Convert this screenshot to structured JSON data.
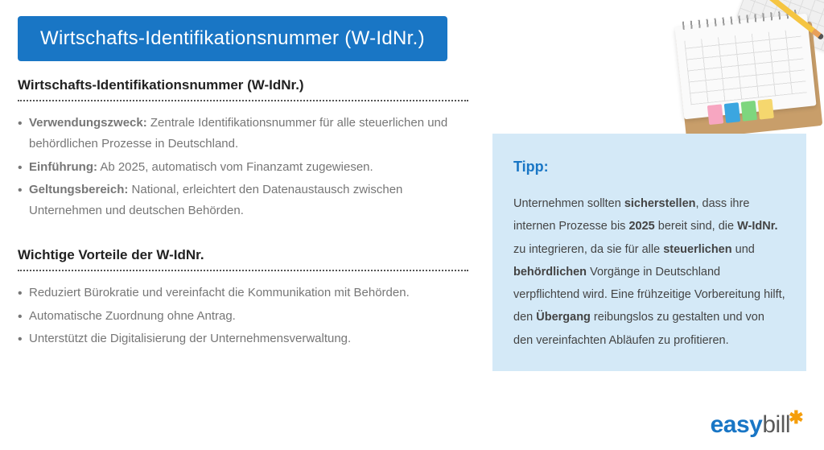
{
  "title": "Wirtschafts-Identifikationsnummer (W-IdNr.)",
  "section1": {
    "heading": "Wirtschafts-Identifikationsnummer (W-IdNr.)",
    "items": [
      {
        "label": "Verwendungszweck:",
        "text": " Zentrale Identifikationsnummer für alle steuerlichen und behördlichen Prozesse in Deutschland."
      },
      {
        "label": "Einführung:",
        "text": " Ab 2025, automatisch vom Finanzamt zugewiesen."
      },
      {
        "label": "Geltungsbereich:",
        "text": " National, erleichtert den Datenaustausch zwischen Unternehmen und deutschen Behörden."
      }
    ]
  },
  "section2": {
    "heading": "Wichtige Vorteile der W-IdNr.",
    "items": [
      "Reduziert Bürokratie und vereinfacht die Kommunikation mit Behörden.",
      "Automatische Zuordnung ohne Antrag.",
      "Unterstützt die Digitalisierung der Unternehmensverwaltung."
    ]
  },
  "tip": {
    "title": "Tipp:",
    "parts": {
      "p0": "Unternehmen sollten ",
      "b1": "sicherstellen",
      "p1": ", dass ihre internen Prozesse bis ",
      "b2": "2025",
      "p2": " bereit sind, die ",
      "b3": "W-IdNr.",
      "p3": " zu integrieren, da sie für alle ",
      "b4": "steuerlichen",
      "p4": " und ",
      "b5": "behördlichen",
      "p5": " Vorgänge in Deutschland verpflichtend wird. Eine frühzeitige Vorbereitung hilft, den ",
      "b6": "Übergang",
      "p6": " reibungslos zu gestalten und von den vereinfachten Abläufen zu profitieren."
    }
  },
  "logo": {
    "part1": "easy",
    "part2": "bill",
    "star": "✱"
  }
}
